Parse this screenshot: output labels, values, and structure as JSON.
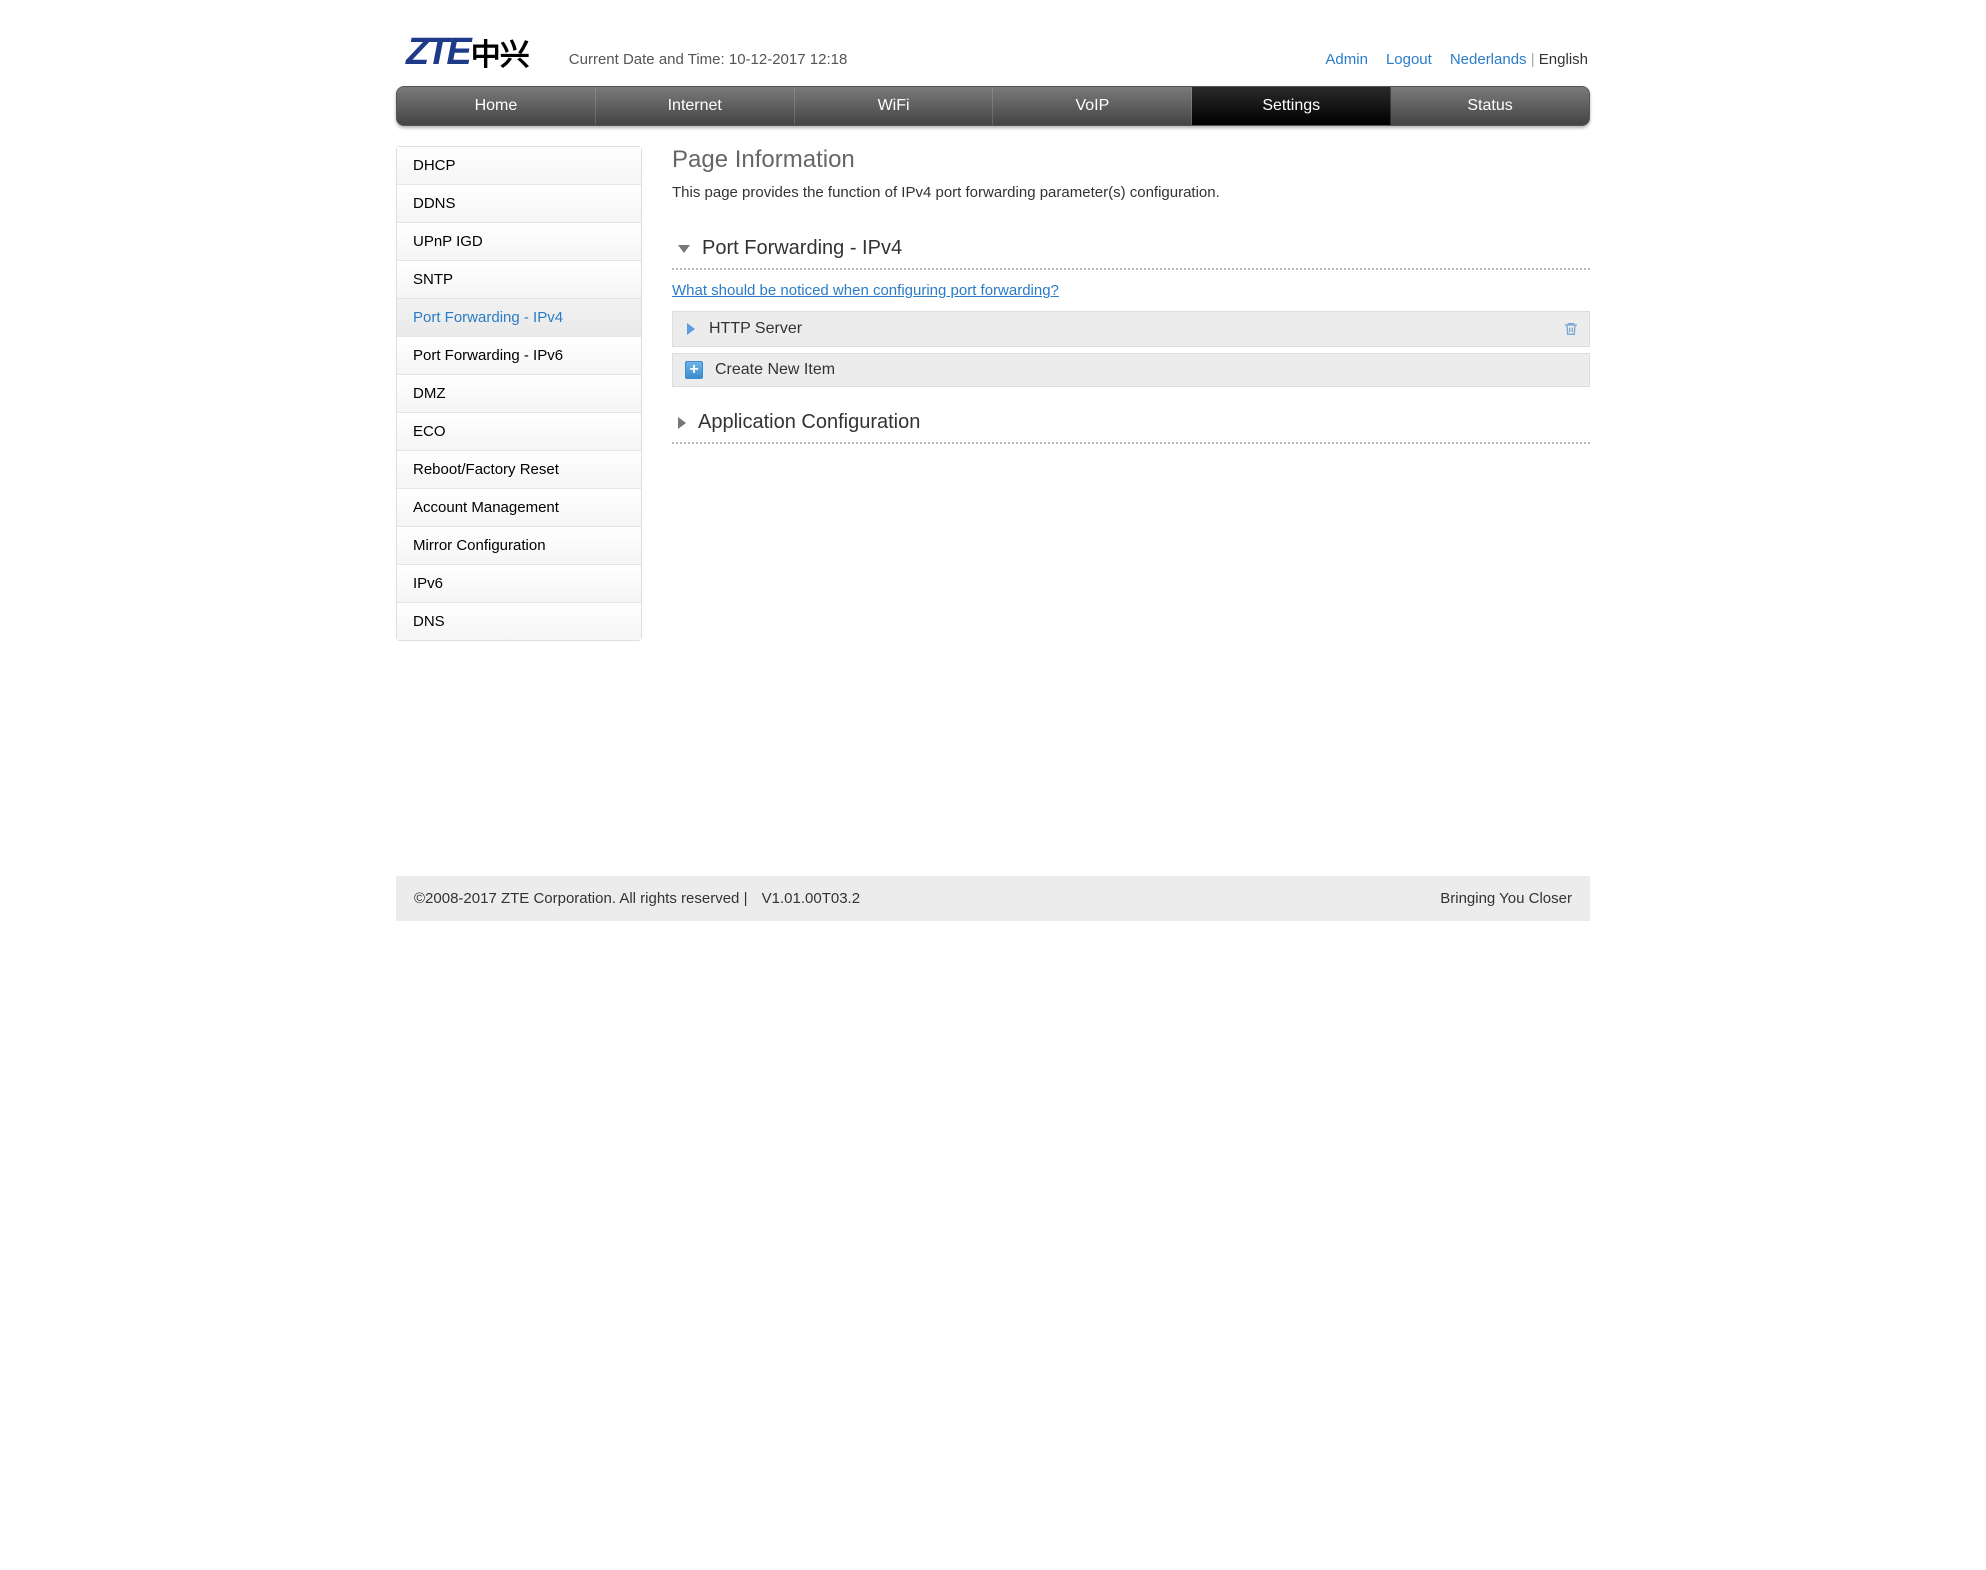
{
  "header": {
    "datetime_prefix": "Current Date and Time: ",
    "datetime_value": "10-12-2017 12:18",
    "links": {
      "admin": "Admin",
      "logout": "Logout"
    },
    "lang": {
      "nl": "Nederlands",
      "en": "English"
    }
  },
  "nav": [
    "Home",
    "Internet",
    "WiFi",
    "VoIP",
    "Settings",
    "Status"
  ],
  "nav_active": 4,
  "sidebar": [
    "DHCP",
    "DDNS",
    "UPnP IGD",
    "SNTP",
    "Port Forwarding - IPv4",
    "Port Forwarding - IPv6",
    "DMZ",
    "ECO",
    "Reboot/Factory Reset",
    "Account Management",
    "Mirror Configuration",
    "IPv6",
    "DNS"
  ],
  "sidebar_active": 4,
  "page": {
    "title": "Page Information",
    "description": "This page provides the function of IPv4 port forwarding parameter(s) configuration."
  },
  "sections": {
    "port_forwarding": {
      "title": "Port Forwarding - IPv4",
      "expanded": true,
      "help_link": "What should be noticed when configuring port forwarding?",
      "items": [
        "HTTP Server"
      ],
      "create_label": "Create New Item"
    },
    "app_config": {
      "title": "Application Configuration",
      "expanded": false
    }
  },
  "footer": {
    "copyright": "©2008-2017 ZTE Corporation. All rights reserved",
    "separator": "  |  ",
    "version": "V1.01.00T03.2",
    "slogan": "Bringing You Closer"
  }
}
